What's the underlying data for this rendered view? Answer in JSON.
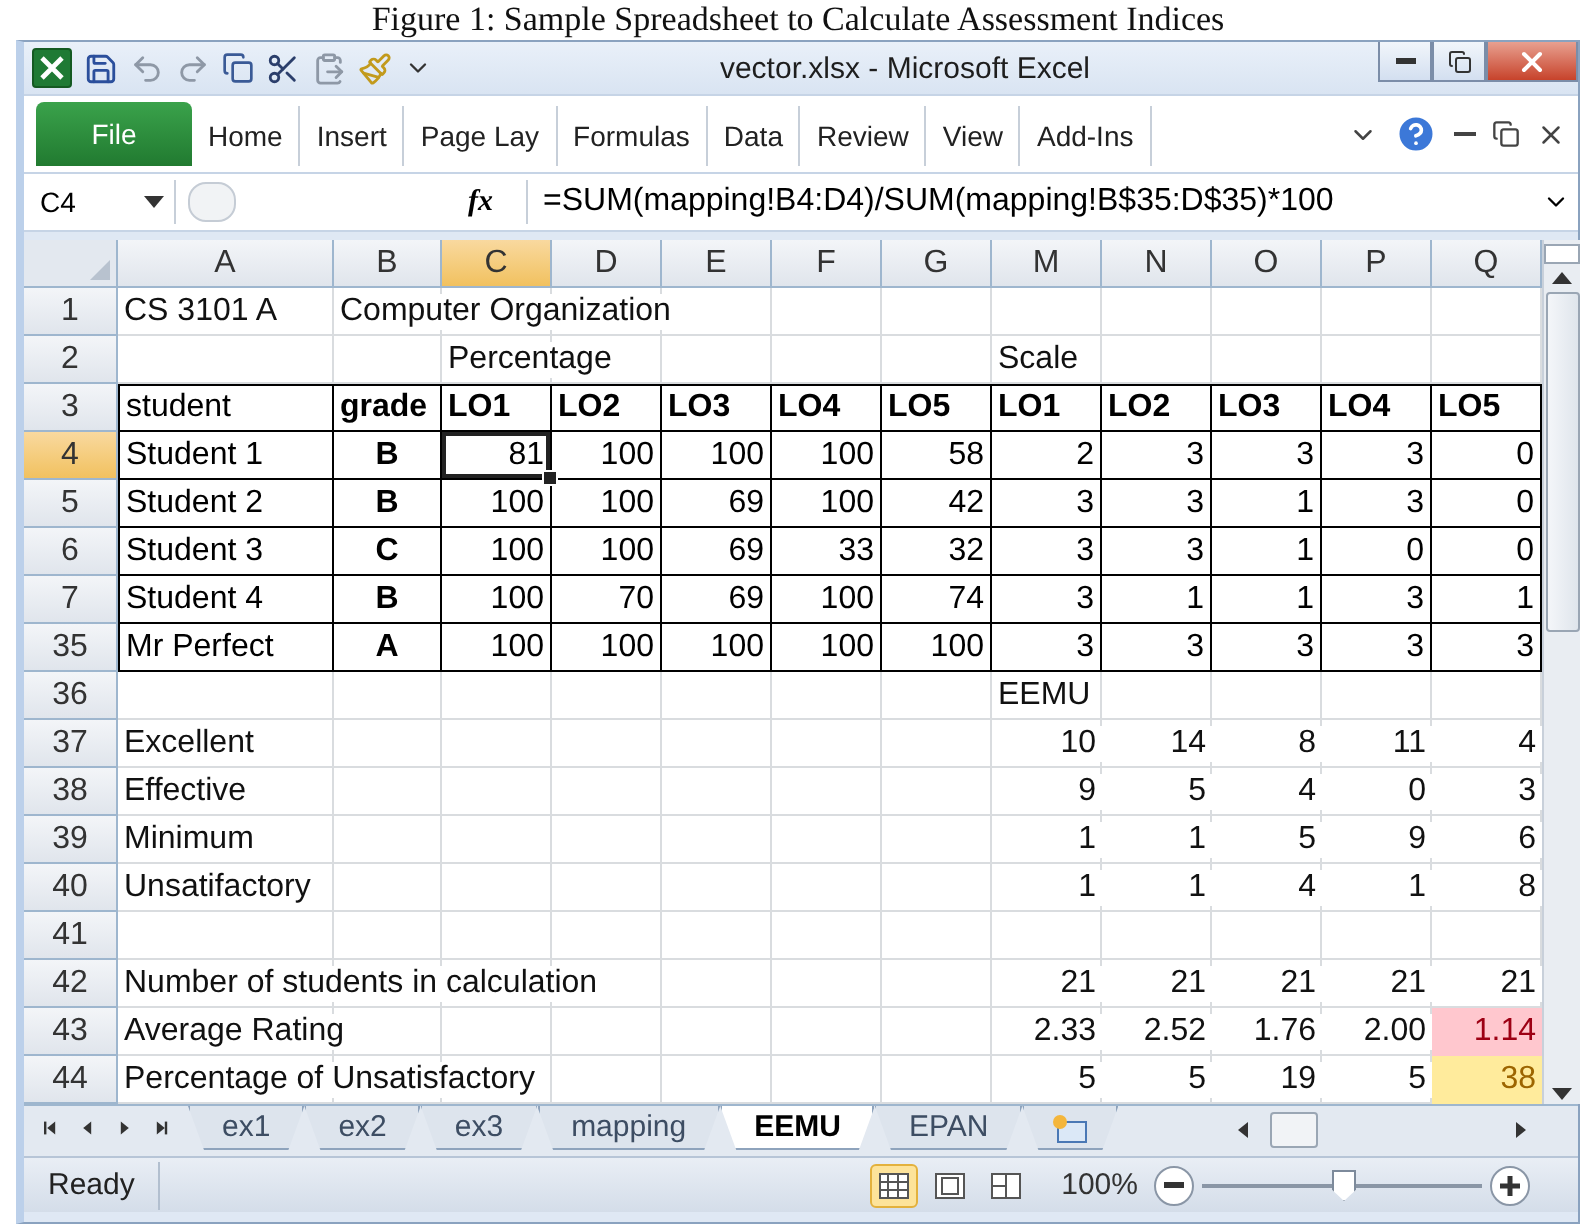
{
  "caption": "Figure 1: Sample Spreadsheet to Calculate Assessment Indices",
  "window": {
    "title": "vector.xlsx - Microsoft Excel"
  },
  "ribbon_tabs": [
    {
      "label": "File",
      "kind": "file"
    },
    {
      "label": "Home",
      "kind": "tab"
    },
    {
      "label": "Insert",
      "kind": "tab"
    },
    {
      "label": "Page Lay",
      "kind": "tab"
    },
    {
      "label": "Formulas",
      "kind": "tab"
    },
    {
      "label": "Data",
      "kind": "tab"
    },
    {
      "label": "Review",
      "kind": "tab"
    },
    {
      "label": "View",
      "kind": "tab"
    },
    {
      "label": "Add-Ins",
      "kind": "tab"
    }
  ],
  "formula_bar": {
    "name_box": "C4",
    "function_label": "fx",
    "formula": "=SUM(mapping!B4:D4)/SUM(mapping!B$35:D$35)*100"
  },
  "columns": [
    {
      "letter": "A",
      "selected": false
    },
    {
      "letter": "B",
      "selected": false
    },
    {
      "letter": "C",
      "selected": true
    },
    {
      "letter": "D",
      "selected": false
    },
    {
      "letter": "E",
      "selected": false
    },
    {
      "letter": "F",
      "selected": false
    },
    {
      "letter": "G",
      "selected": false
    },
    {
      "letter": "M",
      "selected": false
    },
    {
      "letter": "N",
      "selected": false
    },
    {
      "letter": "O",
      "selected": false
    },
    {
      "letter": "P",
      "selected": false
    },
    {
      "letter": "Q",
      "selected": false
    }
  ],
  "rows": [
    {
      "number": "1",
      "selected": false,
      "kind": "title",
      "cells": [
        "CS 3101 A",
        "Computer Organization",
        null,
        null,
        null,
        null,
        null,
        null,
        null,
        null,
        null,
        null
      ]
    },
    {
      "number": "2",
      "selected": false,
      "kind": "title",
      "cells": [
        null,
        null,
        "Percentage",
        null,
        null,
        null,
        null,
        "Scale",
        null,
        null,
        null,
        null
      ]
    },
    {
      "number": "3",
      "selected": false,
      "kind": "head",
      "cells": [
        "student",
        {
          "text": "grade",
          "bold": true
        },
        {
          "text": "LO1",
          "bold": true
        },
        {
          "text": "LO2",
          "bold": true
        },
        {
          "text": "LO3",
          "bold": true
        },
        {
          "text": "LO4",
          "bold": true
        },
        {
          "text": "LO5",
          "bold": true
        },
        {
          "text": "LO1",
          "bold": true
        },
        {
          "text": "LO2",
          "bold": true
        },
        {
          "text": "LO3",
          "bold": true
        },
        {
          "text": "LO4",
          "bold": true
        },
        {
          "text": "LO5",
          "bold": true
        }
      ]
    },
    {
      "number": "4",
      "selected": true,
      "kind": "table",
      "cells": [
        "Student 1",
        {
          "text": "B",
          "bold": true
        },
        {
          "text": "81",
          "selected": true
        },
        "100",
        "100",
        "100",
        "58",
        "2",
        "3",
        "3",
        "3",
        "0"
      ]
    },
    {
      "number": "5",
      "selected": false,
      "kind": "table",
      "cells": [
        "Student 2",
        {
          "text": "B",
          "bold": true
        },
        "100",
        "100",
        "69",
        "100",
        "42",
        "3",
        "3",
        "1",
        "3",
        "0"
      ]
    },
    {
      "number": "6",
      "selected": false,
      "kind": "table",
      "cells": [
        "Student 3",
        {
          "text": "C",
          "bold": true
        },
        "100",
        "100",
        "69",
        "33",
        "32",
        "3",
        "3",
        "1",
        "0",
        "0"
      ]
    },
    {
      "number": "7",
      "selected": false,
      "kind": "table",
      "cells": [
        "Student 4",
        {
          "text": "B",
          "bold": true
        },
        "100",
        "70",
        "69",
        "100",
        "74",
        "3",
        "1",
        "1",
        "3",
        "1"
      ]
    },
    {
      "number": "35",
      "selected": false,
      "kind": "table",
      "cells": [
        "Mr Perfect",
        {
          "text": "A",
          "bold": true
        },
        "100",
        "100",
        "100",
        "100",
        "100",
        "3",
        "3",
        "3",
        "3",
        "3"
      ]
    },
    {
      "number": "36",
      "selected": false,
      "kind": "title",
      "cells": [
        null,
        null,
        null,
        null,
        null,
        null,
        null,
        "EEMU",
        null,
        null,
        null,
        null
      ]
    },
    {
      "number": "37",
      "selected": false,
      "kind": "plain",
      "cells": [
        "Excellent",
        null,
        null,
        null,
        null,
        null,
        null,
        "10",
        "14",
        "8",
        "11",
        "4"
      ]
    },
    {
      "number": "38",
      "selected": false,
      "kind": "plain",
      "cells": [
        "Effective",
        null,
        null,
        null,
        null,
        null,
        null,
        "9",
        "5",
        "4",
        "0",
        "3"
      ]
    },
    {
      "number": "39",
      "selected": false,
      "kind": "plain",
      "cells": [
        "Minimum",
        null,
        null,
        null,
        null,
        null,
        null,
        "1",
        "1",
        "5",
        "9",
        "6"
      ]
    },
    {
      "number": "40",
      "selected": false,
      "kind": "plain",
      "cells": [
        "Unsatifactory",
        null,
        null,
        null,
        null,
        null,
        null,
        "1",
        "1",
        "4",
        "1",
        "8"
      ]
    },
    {
      "number": "41",
      "selected": false,
      "kind": "plain",
      "cells": [
        null,
        null,
        null,
        null,
        null,
        null,
        null,
        null,
        null,
        null,
        null,
        null
      ]
    },
    {
      "number": "42",
      "selected": false,
      "kind": "plain",
      "cells": [
        "Number of students in calculation",
        null,
        null,
        null,
        null,
        null,
        null,
        "21",
        "21",
        "21",
        "21",
        "21"
      ]
    },
    {
      "number": "43",
      "selected": false,
      "kind": "plain",
      "cells": [
        "Average Rating",
        null,
        null,
        null,
        null,
        null,
        null,
        "2.33",
        "2.52",
        "1.76",
        "2.00",
        {
          "text": "1.14",
          "color": "#ffc7ce"
        }
      ]
    },
    {
      "number": "44",
      "selected": false,
      "kind": "plain",
      "cells": [
        "Percentage of Unsatisfactory",
        null,
        null,
        null,
        null,
        null,
        null,
        "5",
        "5",
        "19",
        "5",
        {
          "text": "38",
          "color": "#ffeb9c"
        }
      ]
    }
  ],
  "sheet_tabs": [
    {
      "label": "ex1",
      "selected": false
    },
    {
      "label": "ex2",
      "selected": false
    },
    {
      "label": "ex3",
      "selected": false
    },
    {
      "label": "mapping",
      "selected": false
    },
    {
      "label": "EEMU",
      "selected": true
    },
    {
      "label": "EPAN",
      "selected": false
    }
  ],
  "status_bar": {
    "status": "Ready",
    "views": [
      {
        "kind": "normal",
        "selected": true
      },
      {
        "kind": "layout",
        "selected": false
      },
      {
        "kind": "pagebreak",
        "selected": false
      }
    ],
    "zoom": "100%",
    "zoom_level": {
      "level": 0.5
    }
  }
}
